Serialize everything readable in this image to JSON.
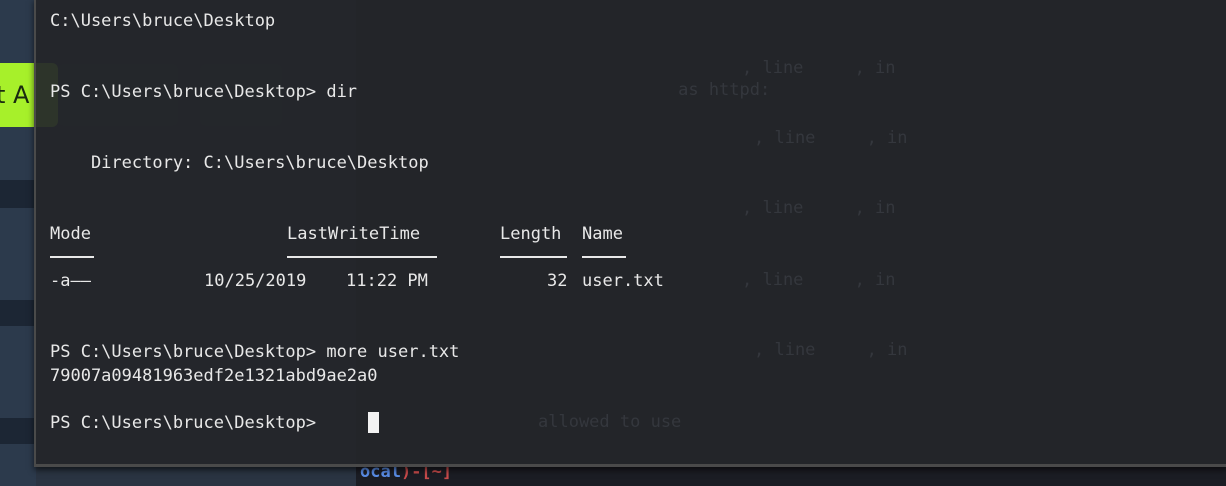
{
  "background": {
    "left_button_text": "t A",
    "ghost_lines": [
      ", line     , in",
      "         as httpd:",
      ", line     , in",
      ", line     , in",
      ", line     , in",
      ", line     , in",
      "allowed to use"
    ],
    "bottom_prompt": "ocal",
    "bottom_prompt_suffix": ")-[~]"
  },
  "terminal": {
    "lines": {
      "cwd_header": "C:\\Users\\bruce\\Desktop",
      "prompt_dir": "PS C:\\Users\\bruce\\Desktop> dir",
      "directory_label": "    Directory: C:\\Users\\bruce\\Desktop",
      "prompt_more": "PS C:\\Users\\bruce\\Desktop> more user.txt",
      "hash_output": "79007a09481963edf2e1321abd9ae2a0",
      "prompt_final": "PS C:\\Users\\bruce\\Desktop> "
    },
    "table": {
      "headers": {
        "mode": "Mode",
        "last_write_time": "LastWriteTime",
        "length": "Length",
        "name": "Name"
      },
      "rows": [
        {
          "mode": "-a——",
          "date": "10/25/2019",
          "time": "11:22 PM",
          "length": "32",
          "name": "user.txt"
        }
      ]
    }
  },
  "colors": {
    "terminal_bg": "#24262a",
    "text": "#e8e8e8",
    "accent_green": "#a7f02a"
  }
}
